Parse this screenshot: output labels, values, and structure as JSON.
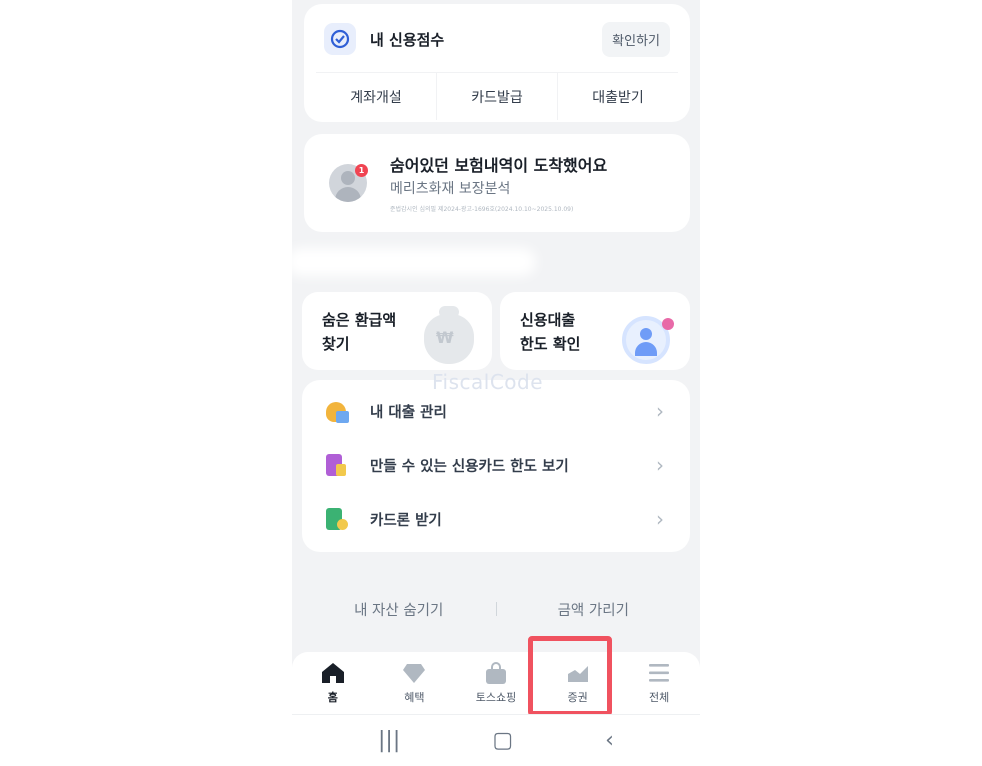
{
  "credit": {
    "title": "내 신용점수",
    "confirm_label": "확인하기",
    "actions": [
      "계좌개설",
      "카드발급",
      "대출받기"
    ]
  },
  "insurance": {
    "badge": "1",
    "title": "숨어있던 보험내역이 도착했어요",
    "subtitle": "메리츠화재 보장분석",
    "note": "준법감시인 심의필 제2024-광고-1696호(2024.10.10~2025.10.09)"
  },
  "tiles": [
    {
      "line1": "숨은 환급액",
      "line2": "찾기",
      "icon": "money-bag-icon"
    },
    {
      "line1": "신용대출",
      "line2": "한도 확인",
      "icon": "person-badge-icon"
    }
  ],
  "watermark": "FiscalCode",
  "list": [
    {
      "label": "내 대출 관리",
      "icon": "loan-icon"
    },
    {
      "label": "만들 수 있는 신용카드 한도 보기",
      "icon": "credit-card-icon"
    },
    {
      "label": "카드론 받기",
      "icon": "card-loan-icon"
    }
  ],
  "bottom_links": [
    "내 자산 숨기기",
    "금액 가리기"
  ],
  "tabs": [
    {
      "label": "홈",
      "icon": "home-icon",
      "active": true
    },
    {
      "label": "혜택",
      "icon": "diamond-icon"
    },
    {
      "label": "토스쇼핑",
      "icon": "shopping-bag-icon"
    },
    {
      "label": "증권",
      "icon": "stock-chart-icon"
    },
    {
      "label": "전체",
      "icon": "menu-icon"
    }
  ],
  "colors": {
    "accent": "#3182f6",
    "highlight": "#f0525f",
    "background": "#f2f3f5"
  }
}
